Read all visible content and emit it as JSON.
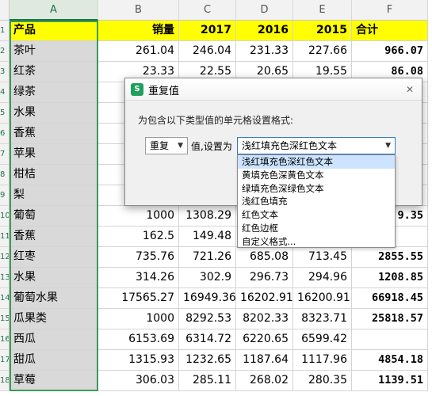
{
  "columns": [
    "A",
    "B",
    "C",
    "D",
    "E",
    "F"
  ],
  "rows": [
    {
      "num": "1",
      "cells": [
        "产品",
        "销量",
        "2017",
        "2016",
        "2015",
        "合计"
      ]
    },
    {
      "num": "2",
      "cells": [
        "茶叶",
        "261.04",
        "246.04",
        "231.33",
        "227.66",
        "966.07"
      ]
    },
    {
      "num": "3",
      "cells": [
        "红茶",
        "23.33",
        "22.55",
        "20.65",
        "19.55",
        "86.08"
      ]
    },
    {
      "num": "4",
      "cells": [
        "绿茶",
        "",
        "",
        "",
        "",
        ""
      ]
    },
    {
      "num": "5",
      "cells": [
        "水果",
        "",
        "",
        "",
        "",
        ""
      ]
    },
    {
      "num": "6",
      "cells": [
        "香蕉",
        "",
        "",
        "",
        "",
        ""
      ]
    },
    {
      "num": "7",
      "cells": [
        "苹果",
        "",
        "",
        "",
        "",
        ""
      ]
    },
    {
      "num": "8",
      "cells": [
        "柑桔",
        "",
        "",
        "",
        "",
        ""
      ]
    },
    {
      "num": "9",
      "cells": [
        "梨",
        "",
        "",
        "",
        "",
        ""
      ]
    },
    {
      "num": "10",
      "cells": [
        "葡萄",
        "1000",
        "1308.29",
        "",
        "",
        "9.35"
      ]
    },
    {
      "num": "11",
      "cells": [
        "香蕉",
        "162.5",
        "149.48",
        "",
        "",
        ""
      ]
    },
    {
      "num": "12",
      "cells": [
        "红枣",
        "735.76",
        "721.26",
        "685.08",
        "713.45",
        "2855.55"
      ]
    },
    {
      "num": "13",
      "cells": [
        "水果",
        "314.26",
        "302.9",
        "296.73",
        "294.96",
        "1208.85"
      ]
    },
    {
      "num": "14",
      "cells": [
        "葡萄水果",
        "17565.27",
        "16949.36",
        "16202.91",
        "16200.91",
        "66918.45"
      ]
    },
    {
      "num": "15",
      "cells": [
        "瓜果类",
        "1000",
        "8292.53",
        "8202.33",
        "8323.71",
        "25818.57"
      ]
    },
    {
      "num": "16",
      "cells": [
        "西瓜",
        "6153.69",
        "6314.72",
        "6220.65",
        "6599.42",
        ""
      ]
    },
    {
      "num": "17",
      "cells": [
        "甜瓜",
        "1315.93",
        "1232.65",
        "1187.64",
        "1117.96",
        "4854.18"
      ]
    },
    {
      "num": "18",
      "cells": [
        "草莓",
        "306.03",
        "285.11",
        "268.02",
        "280.35",
        "1139.51"
      ]
    }
  ],
  "dialog": {
    "title": "重复值",
    "icon_text": "S",
    "prompt": "为包含以下类型值的单元格设置格式:",
    "condition_value": "重复",
    "value_label": "值,设置为",
    "format_value": "浅红填充色深红色文本",
    "format_options": [
      "浅红填充色深红色文本",
      "黄填充色深黄色文本",
      "绿填充色深绿色文本",
      "浅红色填充",
      "红色文本",
      "红色边框",
      "自定义格式..."
    ]
  },
  "colors": {
    "header_fill": "#ffff00",
    "selected_column_fill": "#d9d9d9",
    "selection_border": "#3a9a5a",
    "wps_icon": "#1f9f5b"
  }
}
